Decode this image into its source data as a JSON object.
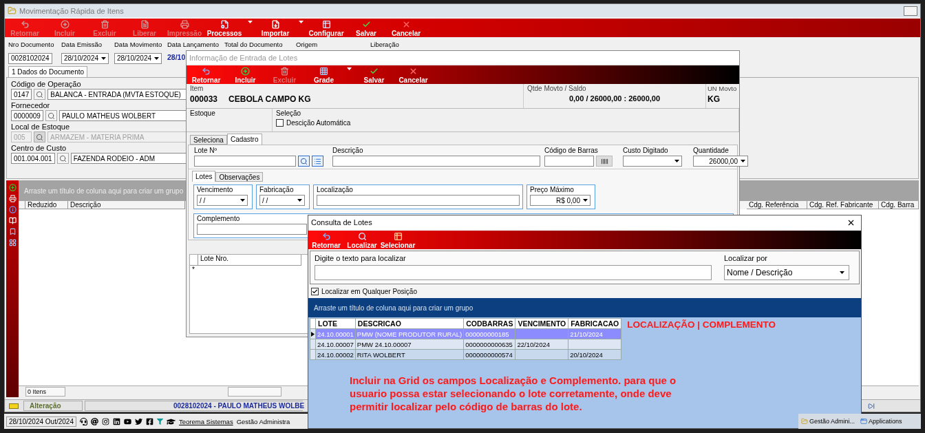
{
  "main_window": {
    "title": "Movimentação Rápida de Itens",
    "toolbar": [
      {
        "label": "Retornar",
        "kind": "back",
        "disabled": true,
        "dropdown": false
      },
      {
        "label": "Incluir",
        "kind": "add",
        "disabled": true,
        "dropdown": false
      },
      {
        "label": "Excluir",
        "kind": "delete",
        "disabled": true,
        "dropdown": false
      },
      {
        "label": "Liberar",
        "kind": "document",
        "disabled": true,
        "dropdown": false
      },
      {
        "label": "Impressão",
        "kind": "print",
        "disabled": true,
        "dropdown": false
      },
      {
        "label": "Processos",
        "kind": "process",
        "disabled": false,
        "dropdown": true
      },
      {
        "label": "Importar",
        "kind": "import",
        "disabled": false,
        "dropdown": true
      },
      {
        "label": "Configurar",
        "kind": "config",
        "disabled": false,
        "dropdown": false
      },
      {
        "label": "Salvar",
        "kind": "save",
        "disabled": false,
        "dropdown": false
      },
      {
        "label": "Cancelar",
        "kind": "cancel",
        "disabled": false,
        "dropdown": false
      }
    ],
    "header_fields": [
      {
        "label": "Nro Documento",
        "kind": "input",
        "value": "0028102024"
      },
      {
        "label": "Data Emissão",
        "kind": "date",
        "value": "28/10/2024"
      },
      {
        "label": "Data Movimento",
        "kind": "date",
        "value": "28/10/2024"
      },
      {
        "label": "Data Lançamento",
        "kind": "text",
        "value": "28/10"
      },
      {
        "label": "Total do Documento",
        "kind": "label"
      },
      {
        "label": "Origem",
        "kind": "label"
      },
      {
        "label": "Liberação",
        "kind": "label"
      }
    ],
    "tabs": [
      {
        "label": "1 Dados do Documento",
        "selected": true
      }
    ],
    "form_rows": [
      {
        "label": "Código de Operação",
        "code": "0147",
        "description": "BALANCA - ENTRADA (MVTA ESTOQUE)",
        "disabled": false
      },
      {
        "label": "Fornecedor",
        "code": "0000009",
        "description": "PAULO MATHEUS WOLBERT",
        "disabled": false
      },
      {
        "label": "Local de Estoque",
        "code": "005",
        "description": "ARMAZEM - MATERIA PRIMA",
        "disabled": true
      },
      {
        "label": "Centro de Custo",
        "code": "001.004.001",
        "description": "FAZENDA RODEIO - ADM",
        "disabled": false
      }
    ],
    "grid": {
      "group_hint": "Arraste um título de coluna aqui para criar um grupo",
      "columns_left": [
        "Reduzido",
        "Descrição"
      ],
      "columns_right": [
        "Cdg. Referência",
        "Cdg. Ref. Fabricante",
        "Cdg. Barra"
      ],
      "count": "0 Itens"
    },
    "status_bar": {
      "mode": "Alteração",
      "document": "0028102024 - PAULO MATHEUS WOLBE"
    },
    "taskbar": {
      "date": "28/10/2024 Out/2024",
      "link": "Teorema Sistemas",
      "app": "Gestão Administra",
      "tray": [
        "Gestão Admini...",
        "Applications"
      ]
    }
  },
  "lotes_window": {
    "title": "Informação de Entrada de Lotes",
    "toolbar": [
      {
        "label": "Retornar",
        "kind": "back",
        "disabled": false,
        "dropdown": false
      },
      {
        "label": "Incluir",
        "kind": "add",
        "disabled": false,
        "dropdown": false
      },
      {
        "label": "Excluir",
        "kind": "delete",
        "disabled": true,
        "dropdown": false
      },
      {
        "label": "Grade",
        "kind": "grid",
        "disabled": false,
        "dropdown": true
      },
      {
        "label": "Salvar",
        "kind": "save",
        "disabled": false,
        "dropdown": false
      },
      {
        "label": "Cancelar",
        "kind": "cancel",
        "disabled": false,
        "dropdown": false
      }
    ],
    "item": {
      "label": "Item",
      "code": "000033",
      "name": "CEBOLA CAMPO KG"
    },
    "quantity": {
      "label": "Qtde Movto / Saldo",
      "value": "0,00 / 26000,00 : 26000,00"
    },
    "unit": {
      "label": "UN Movto",
      "value": "KG"
    },
    "estoque_label": "Estoque",
    "selecao_label": "Seleção",
    "auto_description": {
      "label": "Descição Automática",
      "checked": false
    },
    "tabs": [
      {
        "label": "Seleciona",
        "selected": false
      },
      {
        "label": "Cadastro",
        "selected": true
      }
    ],
    "fields": [
      {
        "label": "Lote Nº",
        "kind": "lookup"
      },
      {
        "label": "Descrição",
        "kind": "text"
      },
      {
        "label": "Código de Barras",
        "kind": "barcode"
      },
      {
        "label": "Custo Digitado",
        "kind": "select"
      },
      {
        "label": "Quantidade",
        "kind": "select",
        "value": "26000,00"
      }
    ],
    "inner_tabs": [
      {
        "label": "Lotes",
        "selected": true
      },
      {
        "label": "Observações",
        "selected": false
      }
    ],
    "groups": [
      {
        "label": "Vencimento",
        "kind": "select",
        "value": "/ /"
      },
      {
        "label": "Fabricação",
        "kind": "select",
        "value": "/ /"
      },
      {
        "label": "Localização",
        "kind": "text"
      },
      {
        "label": "Preço Máximo",
        "kind": "select",
        "value": "R$ 0,00"
      }
    ],
    "complemento_label": "Complemento",
    "grid": {
      "column": "Lote Nro.",
      "new_row_marker": "*"
    }
  },
  "consulta_window": {
    "title": "Consulta de Lotes",
    "toolbar": [
      {
        "label": "Retornar",
        "kind": "back",
        "disabled": false,
        "dropdown": false
      },
      {
        "label": "Localizar",
        "kind": "search",
        "disabled": false,
        "dropdown": false
      },
      {
        "label": "Selecionar",
        "kind": "select",
        "disabled": false,
        "dropdown": false
      }
    ],
    "search": {
      "label": "Digite o texto para localizar"
    },
    "search_by": {
      "label": "Localizar por",
      "value": "Nome / Descrição"
    },
    "any_position": {
      "label": "Localizar em Qualquer Posição",
      "checked": true
    },
    "group_hint": "Arraste um título de coluna aqui para criar um grupo",
    "columns": [
      "LOTE",
      "DESCRICAO",
      "CODBARRAS",
      "VENCIMENTO",
      "FABRICACAO"
    ],
    "rows": [
      {
        "selected": true,
        "cells": [
          "24.10.00001",
          "PMW (NOME PRODUTOR RURAL)",
          "000000000185",
          "",
          "21/10/2024"
        ]
      },
      {
        "selected": false,
        "cells": [
          "24.10.00007",
          "PMW 24.10.00007",
          "0000000000635",
          "22/10/2024",
          ""
        ]
      },
      {
        "selected": false,
        "cells": [
          "24.10.00002",
          "RITA WOLBERT",
          "0000000000574",
          "",
          "20/10/2024"
        ]
      }
    ],
    "annotation_title": "LOCALIZAÇÃO | COMPLEMENTO",
    "annotation": "Incluir na Grid os campos Localização e Complemento. para que o usuario possa estar selecionando o lote corretamente, onde deve permitir localizar pelo código de barras do lote."
  }
}
